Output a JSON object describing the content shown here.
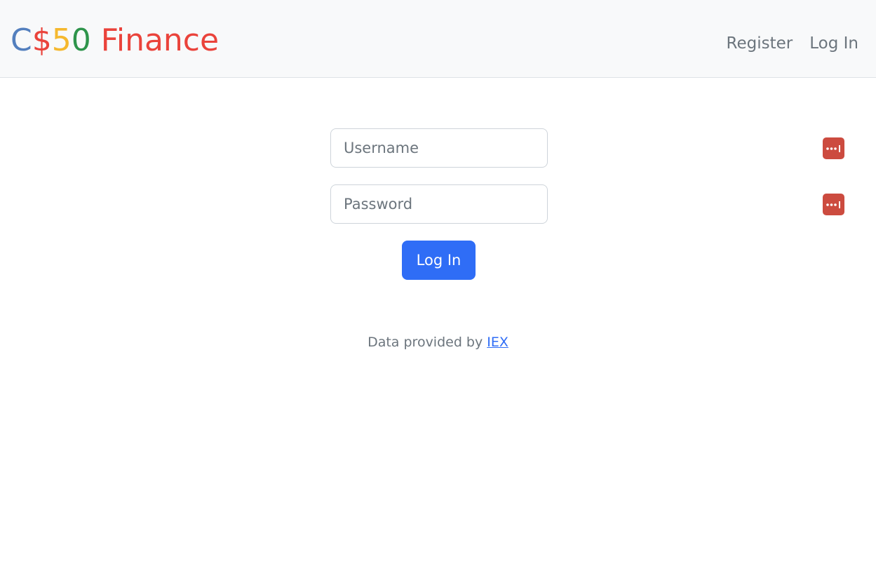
{
  "brand": {
    "parts": [
      {
        "text": "C",
        "color": "#537fbe"
      },
      {
        "text": "$",
        "color": "#ea433b"
      },
      {
        "text": "5",
        "color": "#f5b82e"
      },
      {
        "text": "0",
        "color": "#2e944b"
      },
      {
        "text": "Finance",
        "color": "#ea433b"
      }
    ]
  },
  "nav": {
    "register_label": "Register",
    "login_label": "Log In"
  },
  "form": {
    "username_placeholder": "Username",
    "password_placeholder": "Password",
    "submit_label": "Log In"
  },
  "footer": {
    "prefix": "Data provided by ",
    "link_text": "IEX"
  },
  "colors": {
    "accent": "#2f6df6",
    "password_manager_badge": "#cc4b3f",
    "navbar_bg": "#f8f9fa"
  },
  "icons": {
    "password_manager": "password-dots-icon"
  }
}
